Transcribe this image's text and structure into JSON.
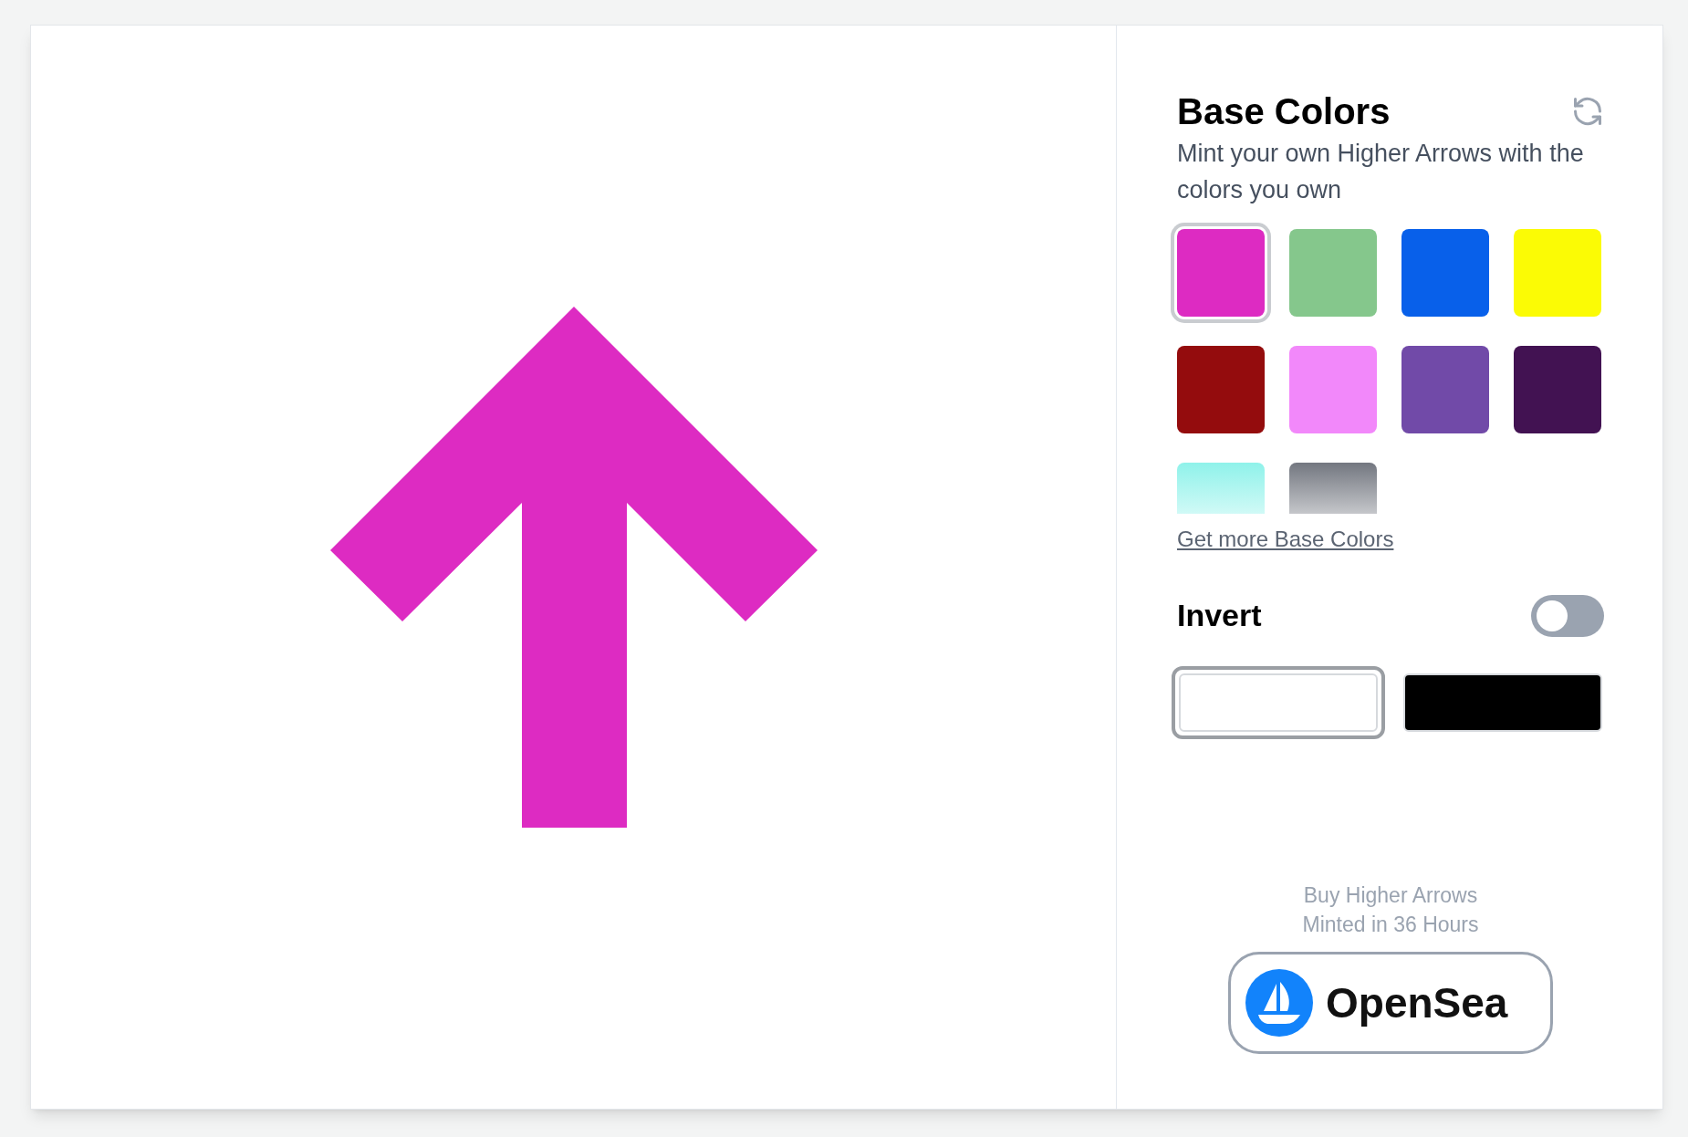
{
  "title": "Base Colors",
  "subtitle": "Mint your own Higher Arrows with the colors you own",
  "swatches": [
    {
      "kind": "solid",
      "color": "#dd2bc2",
      "selected": true
    },
    {
      "kind": "solid",
      "color": "#85c78c",
      "selected": false
    },
    {
      "kind": "solid",
      "color": "#0860ea",
      "selected": false
    },
    {
      "kind": "solid",
      "color": "#fbfb05",
      "selected": false
    },
    {
      "kind": "solid",
      "color": "#940c0d",
      "selected": false
    },
    {
      "kind": "solid",
      "color": "#f288fa",
      "selected": false
    },
    {
      "kind": "solid",
      "color": "#714aa8",
      "selected": false
    },
    {
      "kind": "solid",
      "color": "#421252",
      "selected": false
    },
    {
      "kind": "gradient",
      "color": "#8ff2ea",
      "selected": false
    },
    {
      "kind": "gradient",
      "color": "#737780",
      "selected": false
    }
  ],
  "more_link": "Get more Base Colors",
  "invert": {
    "label": "Invert",
    "on": false
  },
  "backgrounds": [
    {
      "color": "#ffffff",
      "selected": true
    },
    {
      "color": "#000000",
      "selected": false
    }
  ],
  "buy_note": [
    "Buy Higher Arrows",
    "Minted in 36 Hours"
  ],
  "market_button": "OpenSea"
}
